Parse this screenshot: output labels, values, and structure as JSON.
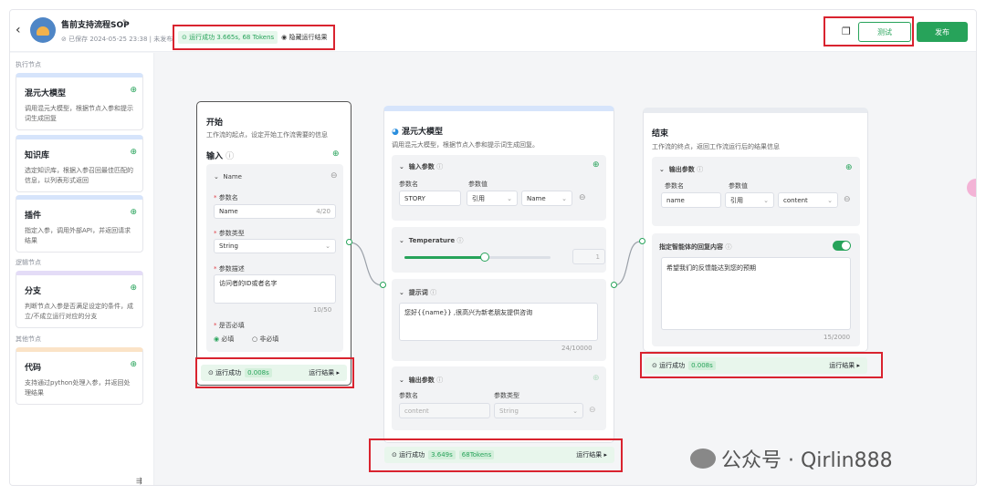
{
  "header": {
    "back_icon": "chevron-left-icon",
    "title": "售前支持流程SOP",
    "saved": "已保存 2024-05-25 23:38 | 未发布",
    "run_status": "运行成功 3.665s,",
    "run_tokens": "68 Tokens",
    "hide_result": "隐藏运行结果",
    "test_label": "测试",
    "publish_label": "发布"
  },
  "sidebar": {
    "section1": "执行节点",
    "section2": "逻辑节点",
    "section3": "其他节点",
    "cards": [
      {
        "title": "混元大模型",
        "desc": "调用混元大模型，根据节点入参和提示词生成回复"
      },
      {
        "title": "知识库",
        "desc": "选定知识库，根据入参召回最佳匹配的信息，以列表形式返回"
      },
      {
        "title": "插件",
        "desc": "指定入参，调用外部API，并返回请求结果"
      },
      {
        "title": "分支",
        "desc": "判断节点入参是否满足设定的条件，成立/不成立运行对应的分支"
      },
      {
        "title": "代码",
        "desc": "支持通过python处理入参，并返回处理结果"
      }
    ]
  },
  "start_node": {
    "title": "开始",
    "desc": "工作流的起点，设定开始工作流需要的信息",
    "input_label": "输入",
    "param_header": "Name",
    "name_label": "参数名",
    "name_value": "Name",
    "name_count": "4/20",
    "type_label": "参数类型",
    "type_value": "String",
    "desc_label": "参数描述",
    "desc_value": "访问者的ID或者名字",
    "desc_count": "10/50",
    "required_label": "是否必填",
    "required_yes": "必填",
    "required_no": "非必填",
    "run_ok": "运行成功",
    "run_time": "0.008s",
    "run_result": "运行结果"
  },
  "llm_node": {
    "title": "混元大模型",
    "desc": "调用混元大模型，根据节点入参和提示词生成回复。",
    "input_params": "输入参数",
    "col_name": "参数名",
    "col_value": "参数值",
    "param_name": "STORY",
    "ref": "引用",
    "ref_value": "Name",
    "temperature": "Temperature",
    "temp_value": "1",
    "temp_level": 0.55,
    "prompt_label": "提示词",
    "prompt_text": "您好{{name}} ,很高兴为新老朋友提供咨询",
    "prompt_count": "24/10000",
    "output_params": "输出参数",
    "out_col_name": "参数名",
    "out_col_type": "参数类型",
    "out_name": "content",
    "out_type": "String",
    "run_ok": "运行成功",
    "run_time": "3.649s",
    "run_tokens": "68Tokens",
    "run_result": "运行结果"
  },
  "end_node": {
    "title": "结束",
    "desc": "工作流的终点，返回工作流运行后的结果信息",
    "output_params": "输出参数",
    "col_name": "参数名",
    "col_value": "参数值",
    "param_name": "name",
    "ref": "引用",
    "ref_value": "content",
    "reply_label": "指定智能体的回复内容",
    "reply_text": "希望我们的反馈能达到您的预期",
    "reply_count": "15/2000",
    "run_ok": "运行成功",
    "run_time": "0.008s",
    "run_result": "运行结果"
  },
  "watermark": "公众号 · Qirlin888",
  "colors": {
    "accent": "#27a35a",
    "highlight": "#d9232f"
  }
}
